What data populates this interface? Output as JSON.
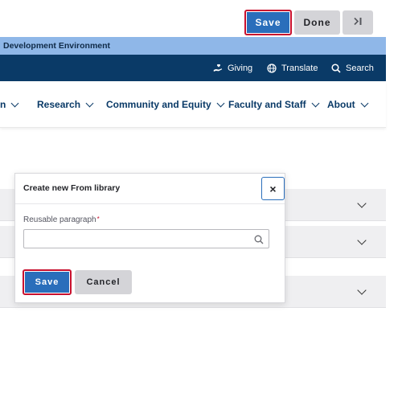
{
  "toolbar": {
    "save_label": "Save",
    "done_label": "Done",
    "collapse_icon": "panel-collapse-icon"
  },
  "environment_banner": {
    "text": "Development Environment"
  },
  "utility_bar": {
    "links": [
      {
        "label": "Giving",
        "icon": "hand-heart-icon"
      },
      {
        "label": "Translate",
        "icon": "globe-icon"
      },
      {
        "label": "Search",
        "icon": "search-icon"
      }
    ]
  },
  "main_nav": {
    "items": [
      {
        "label": "n"
      },
      {
        "label": "Research"
      },
      {
        "label": "Community and Equity"
      },
      {
        "label": "Faculty and Staff"
      },
      {
        "label": "About"
      }
    ]
  },
  "dialog": {
    "title": "Create new From library",
    "close_label": "×",
    "field_label": "Reusable paragraph",
    "required_marker": "*",
    "field_value": "",
    "save_label": "Save",
    "cancel_label": "Cancel"
  },
  "colors": {
    "primary": "#2a6ebb",
    "focus_outline": "#c8102e",
    "navy": "#0a3a67",
    "banner": "#8fb7e8",
    "secondary_button": "#d4d4d8"
  }
}
